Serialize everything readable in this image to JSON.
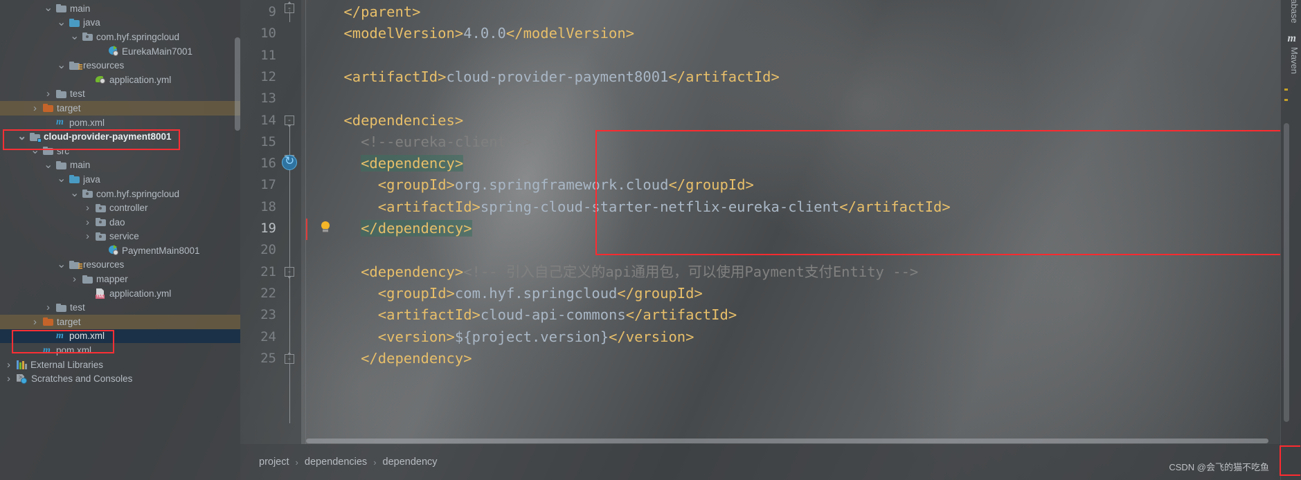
{
  "app": "IntelliJ IDEA",
  "project_tree": {
    "name": "Project",
    "rows": [
      {
        "indent": 3,
        "arrow": "v",
        "icon": "folder-grey",
        "label": "main",
        "state": "normal"
      },
      {
        "indent": 4,
        "arrow": "v",
        "icon": "folder-blue",
        "label": "java",
        "state": "normal"
      },
      {
        "indent": 5,
        "arrow": "v",
        "icon": "folder-package",
        "label": "com.hyf.springcloud",
        "state": "normal"
      },
      {
        "indent": 7,
        "arrow": "none",
        "icon": "spring-class",
        "label": "EurekaMain7001",
        "state": "normal"
      },
      {
        "indent": 4,
        "arrow": "v",
        "icon": "folder-resources",
        "label": "resources",
        "state": "normal"
      },
      {
        "indent": 6,
        "arrow": "none",
        "icon": "spring-yml",
        "label": "application.yml",
        "state": "normal"
      },
      {
        "indent": 3,
        "arrow": ">",
        "icon": "folder-grey",
        "label": "test",
        "state": "normal"
      },
      {
        "indent": 2,
        "arrow": ">",
        "icon": "folder-orange",
        "label": "target",
        "state": "highlight"
      },
      {
        "indent": 3,
        "arrow": "none",
        "icon": "maven-m",
        "label": "pom.xml",
        "state": "normal"
      },
      {
        "indent": 1,
        "arrow": "v",
        "icon": "module",
        "label": "cloud-provider-payment8001",
        "state": "bold"
      },
      {
        "indent": 2,
        "arrow": "v",
        "icon": "folder-grey",
        "label": "src",
        "state": "normal"
      },
      {
        "indent": 3,
        "arrow": "v",
        "icon": "folder-grey",
        "label": "main",
        "state": "normal"
      },
      {
        "indent": 4,
        "arrow": "v",
        "icon": "folder-blue",
        "label": "java",
        "state": "normal"
      },
      {
        "indent": 5,
        "arrow": "v",
        "icon": "folder-package",
        "label": "com.hyf.springcloud",
        "state": "normal"
      },
      {
        "indent": 6,
        "arrow": ">",
        "icon": "folder-package",
        "label": "controller",
        "state": "normal"
      },
      {
        "indent": 6,
        "arrow": ">",
        "icon": "folder-package",
        "label": "dao",
        "state": "normal"
      },
      {
        "indent": 6,
        "arrow": ">",
        "icon": "folder-package",
        "label": "service",
        "state": "normal"
      },
      {
        "indent": 7,
        "arrow": "none",
        "icon": "spring-class",
        "label": "PaymentMain8001",
        "state": "normal"
      },
      {
        "indent": 4,
        "arrow": "v",
        "icon": "folder-resources",
        "label": "resources",
        "state": "normal"
      },
      {
        "indent": 5,
        "arrow": ">",
        "icon": "folder-grey",
        "label": "mapper",
        "state": "normal"
      },
      {
        "indent": 6,
        "arrow": "none",
        "icon": "yml",
        "label": "application.yml",
        "state": "normal"
      },
      {
        "indent": 3,
        "arrow": ">",
        "icon": "folder-grey",
        "label": "test",
        "state": "normal"
      },
      {
        "indent": 2,
        "arrow": ">",
        "icon": "folder-orange",
        "label": "target",
        "state": "highlight"
      },
      {
        "indent": 3,
        "arrow": "none",
        "icon": "maven-m",
        "label": "pom.xml",
        "state": "selected"
      },
      {
        "indent": 2,
        "arrow": "none",
        "icon": "maven-m",
        "label": "pom.xml",
        "state": "normal"
      },
      {
        "indent": 0,
        "arrow": ">",
        "icon": "external-lib",
        "label": "External Libraries",
        "state": "normal"
      },
      {
        "indent": 0,
        "arrow": ">",
        "icon": "scratches",
        "label": "Scratches and Consoles",
        "state": "normal"
      }
    ]
  },
  "editor": {
    "lines": [
      {
        "num": "9",
        "indent": 2,
        "segments": [
          {
            "t": "tag",
            "v": "</parent>"
          }
        ]
      },
      {
        "num": "10",
        "indent": 2,
        "segments": [
          {
            "t": "tag",
            "v": "<modelVersion>"
          },
          {
            "t": "val",
            "v": "4.0.0"
          },
          {
            "t": "tag",
            "v": "</modelVersion>"
          }
        ]
      },
      {
        "num": "11",
        "indent": 0,
        "segments": []
      },
      {
        "num": "12",
        "indent": 2,
        "segments": [
          {
            "t": "tag",
            "v": "<artifactId>"
          },
          {
            "t": "val",
            "v": "cloud-provider-payment8001"
          },
          {
            "t": "tag",
            "v": "</artifactId>"
          }
        ]
      },
      {
        "num": "13",
        "indent": 0,
        "segments": []
      },
      {
        "num": "14",
        "indent": 2,
        "segments": [
          {
            "t": "tag",
            "v": "<dependencies>"
          }
        ]
      },
      {
        "num": "15",
        "indent": 3,
        "segments": [
          {
            "t": "comment",
            "v": "<!--eureka-client-->"
          }
        ]
      },
      {
        "num": "16",
        "indent": 3,
        "segments": [
          {
            "t": "tag-hl",
            "v": "<dependency>"
          }
        ]
      },
      {
        "num": "17",
        "indent": 4,
        "segments": [
          {
            "t": "tag",
            "v": "<groupId>"
          },
          {
            "t": "val",
            "v": "org.springframework.cloud"
          },
          {
            "t": "tag",
            "v": "</groupId>"
          }
        ]
      },
      {
        "num": "18",
        "indent": 4,
        "segments": [
          {
            "t": "tag",
            "v": "<artifactId>"
          },
          {
            "t": "val",
            "v": "spring-cloud-starter-netflix-eureka-client"
          },
          {
            "t": "tag",
            "v": "</artifactId>"
          }
        ]
      },
      {
        "num": "19",
        "indent": 3,
        "segments": [
          {
            "t": "tag-hl",
            "v": "</dependency>"
          }
        ]
      },
      {
        "num": "20",
        "indent": 0,
        "segments": []
      },
      {
        "num": "21",
        "indent": 3,
        "segments": [
          {
            "t": "tag",
            "v": "<dependency>"
          },
          {
            "t": "comment",
            "v": "<!-- 引入自己定义的api通用包，可以使用Payment支付Entity -->"
          }
        ]
      },
      {
        "num": "22",
        "indent": 4,
        "segments": [
          {
            "t": "tag",
            "v": "<groupId>"
          },
          {
            "t": "val",
            "v": "com.hyf.springcloud"
          },
          {
            "t": "tag",
            "v": "</groupId>"
          }
        ]
      },
      {
        "num": "23",
        "indent": 4,
        "segments": [
          {
            "t": "tag",
            "v": "<artifactId>"
          },
          {
            "t": "val",
            "v": "cloud-api-commons"
          },
          {
            "t": "tag",
            "v": "</artifactId>"
          }
        ]
      },
      {
        "num": "24",
        "indent": 4,
        "segments": [
          {
            "t": "tag",
            "v": "<version>"
          },
          {
            "t": "val",
            "v": "${project.version}"
          },
          {
            "t": "tag",
            "v": "</version>"
          }
        ]
      },
      {
        "num": "25",
        "indent": 3,
        "segments": [
          {
            "t": "tag",
            "v": "</dependency>"
          }
        ]
      }
    ],
    "current_line": "19"
  },
  "breadcrumb": {
    "items": [
      "project",
      "dependencies",
      "dependency"
    ],
    "separator": "›"
  },
  "right_strip": {
    "tools": [
      "Database",
      "Maven"
    ],
    "maven_icon_letter": "m"
  },
  "watermark": "CSDN @会飞的猫不吃鱼",
  "colors": {
    "annotation_red": "#fd2b30",
    "tag_yellow": "#e8bf6a",
    "value_blue": "#a9b7c6",
    "comment_grey": "#808080",
    "selection_blue": "#1b3147",
    "match_highlight": "#3d705f"
  }
}
